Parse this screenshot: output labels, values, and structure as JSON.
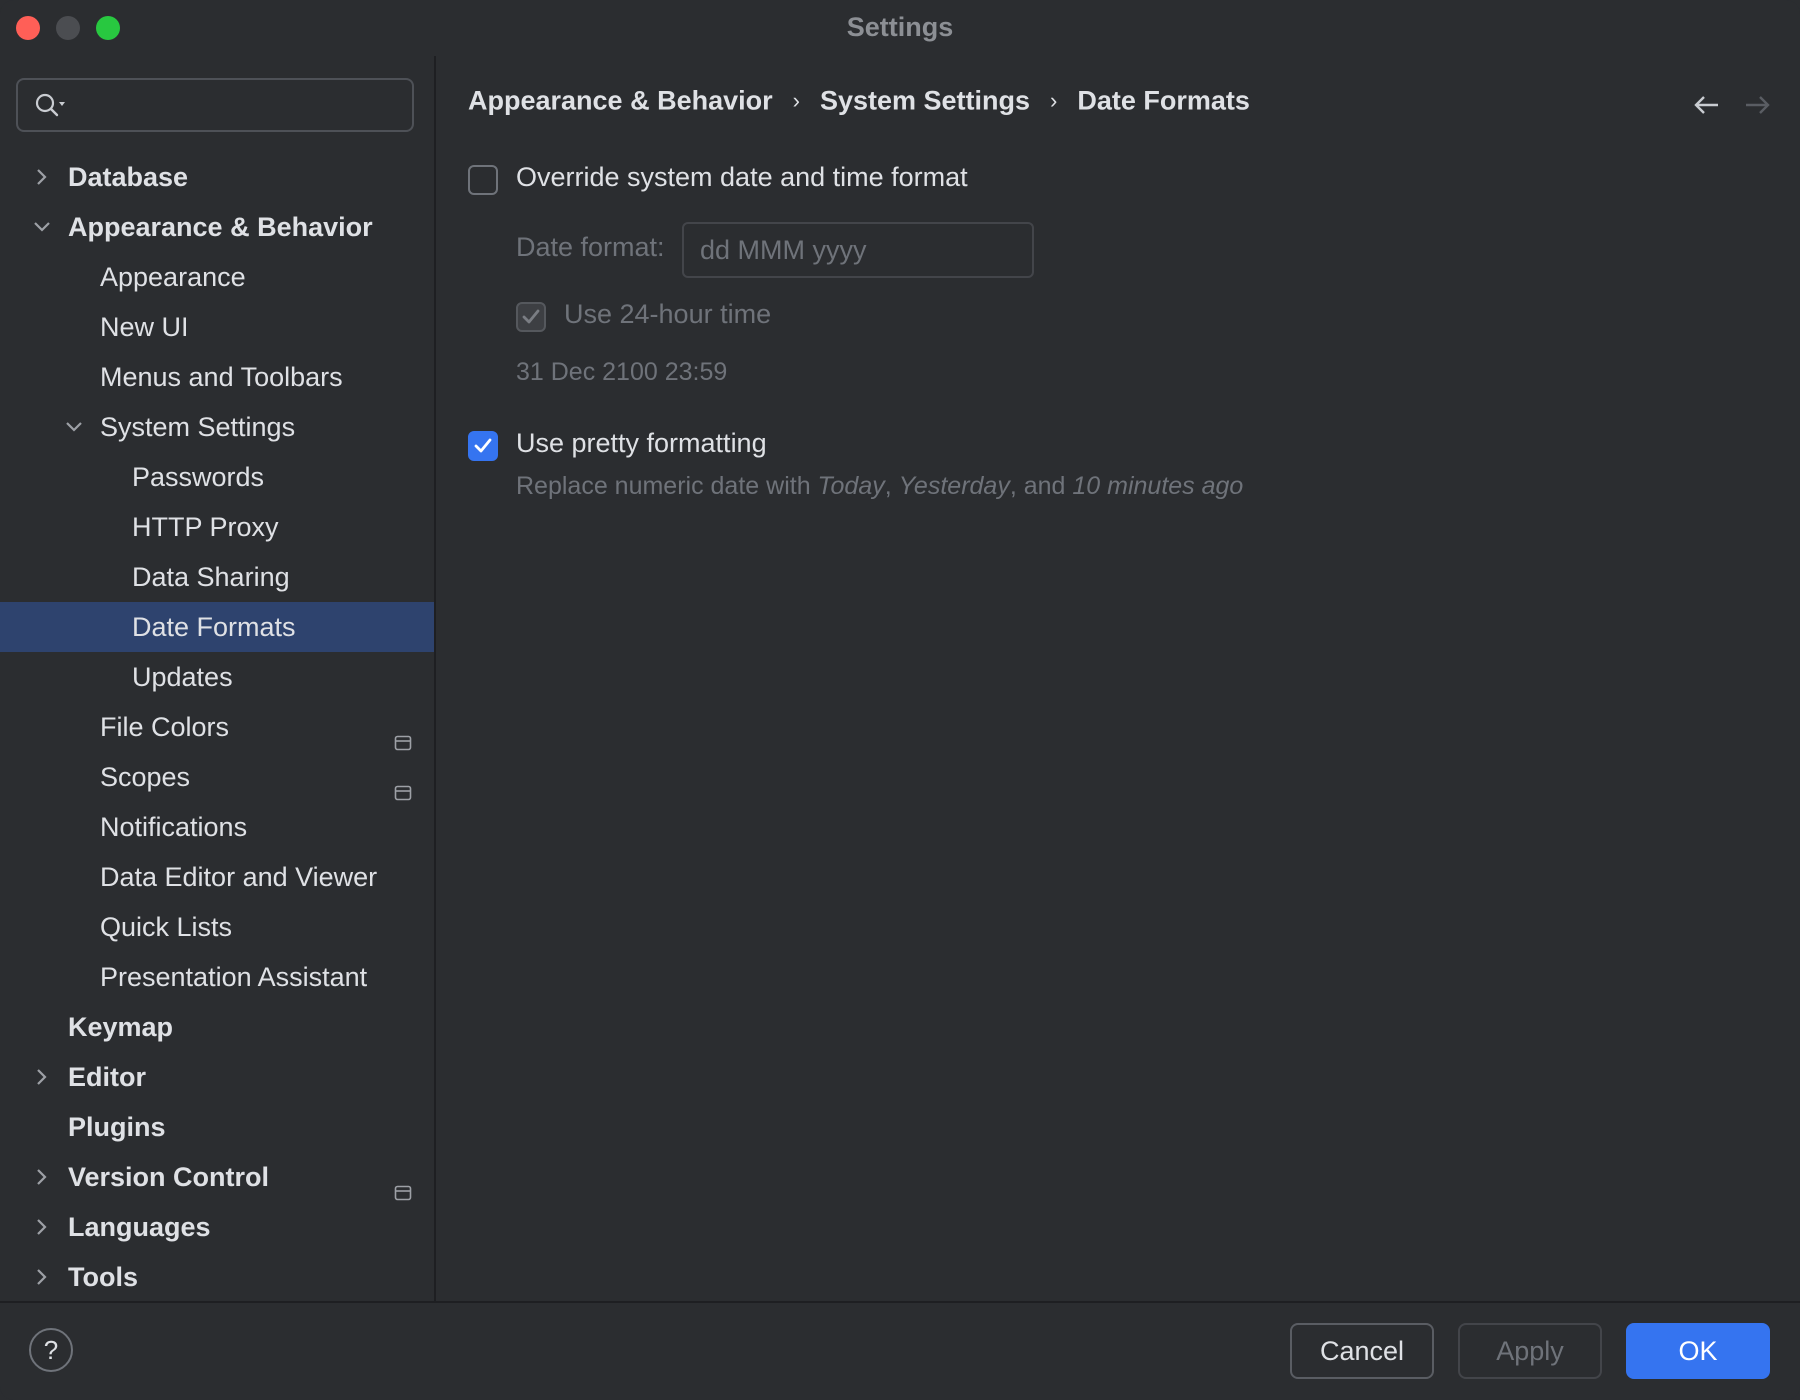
{
  "window": {
    "title": "Settings"
  },
  "search": {
    "placeholder": ""
  },
  "sidebar": {
    "items": [
      {
        "label": "Database",
        "level": 0,
        "bold": true,
        "chevron": "right"
      },
      {
        "label": "Appearance & Behavior",
        "level": 0,
        "bold": true,
        "chevron": "down"
      },
      {
        "label": "Appearance",
        "level": 1
      },
      {
        "label": "New UI",
        "level": 1
      },
      {
        "label": "Menus and Toolbars",
        "level": 1
      },
      {
        "label": "System Settings",
        "level": 1,
        "chevron": "down"
      },
      {
        "label": "Passwords",
        "level": 2
      },
      {
        "label": "HTTP Proxy",
        "level": 2
      },
      {
        "label": "Data Sharing",
        "level": 2
      },
      {
        "label": "Date Formats",
        "level": 2,
        "selected": true
      },
      {
        "label": "Updates",
        "level": 2
      },
      {
        "label": "File Colors",
        "level": 1,
        "badge": "project-settings-icon"
      },
      {
        "label": "Scopes",
        "level": 1,
        "badge": "project-settings-icon"
      },
      {
        "label": "Notifications",
        "level": 1
      },
      {
        "label": "Data Editor and Viewer",
        "level": 1
      },
      {
        "label": "Quick Lists",
        "level": 1
      },
      {
        "label": "Presentation Assistant",
        "level": 1
      },
      {
        "label": "Keymap",
        "level": 0,
        "bold": true
      },
      {
        "label": "Editor",
        "level": 0,
        "bold": true,
        "chevron": "right"
      },
      {
        "label": "Plugins",
        "level": 0,
        "bold": true
      },
      {
        "label": "Version Control",
        "level": 0,
        "bold": true,
        "chevron": "right",
        "badge": "project-settings-icon"
      },
      {
        "label": "Languages",
        "level": 0,
        "bold": true,
        "chevron": "right"
      },
      {
        "label": "Tools",
        "level": 0,
        "bold": true,
        "chevron": "right"
      }
    ]
  },
  "breadcrumb": {
    "items": [
      "Appearance & Behavior",
      "System Settings",
      "Date Formats"
    ],
    "separator": "›"
  },
  "main": {
    "override": {
      "label": "Override system date and time format",
      "checked": false
    },
    "date_format": {
      "label": "Date format:",
      "value": "dd MMM yyyy"
    },
    "use_24h": {
      "label": "Use 24-hour time",
      "checked": true,
      "disabled": true
    },
    "preview": "31 Dec 2100 23:59",
    "pretty": {
      "label": "Use pretty formatting",
      "checked": true
    },
    "pretty_hint": {
      "prefix": "Replace numeric date with ",
      "term1": "Today",
      "sep1": ", ",
      "term2": "Yesterday",
      "sep2": ", and ",
      "term3": "10 minutes ago"
    }
  },
  "footer": {
    "help_label": "?",
    "cancel_label": "Cancel",
    "apply_label": "Apply",
    "ok_label": "OK"
  },
  "colors": {
    "background": "#2b2d30",
    "selection": "#2e436e",
    "accent": "#3574f0",
    "text": "#dfe1e5",
    "text_disabled": "#6f737a"
  }
}
